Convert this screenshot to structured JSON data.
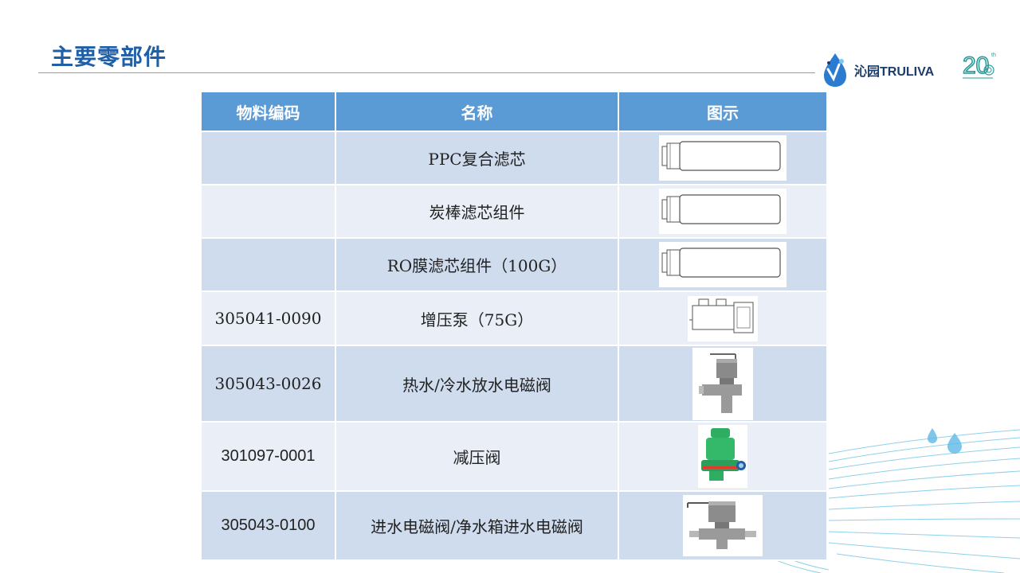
{
  "header": {
    "title": "主要零部件",
    "brand": "沁园TRULIVA",
    "anniversary_number": "20",
    "anniversary_suffix": "th"
  },
  "table": {
    "columns": [
      "物料编码",
      "名称",
      "图示"
    ],
    "rows": [
      {
        "code": "",
        "name": "PPC复合滤芯",
        "image": "filter-cartridge"
      },
      {
        "code": "",
        "name": "炭棒滤芯组件",
        "image": "filter-cartridge"
      },
      {
        "code": "",
        "name": "RO膜滤芯组件（100G）",
        "image": "filter-cartridge"
      },
      {
        "code": "305041-0090",
        "name": "增压泵（75G）",
        "image": "booster-pump"
      },
      {
        "code": "305043-0026",
        "name": "热水/冷水放水电磁阀",
        "image": "solenoid-valve"
      },
      {
        "code": "301097-0001",
        "name": "减压阀",
        "image": "pressure-reducing-valve"
      },
      {
        "code": "305043-0100",
        "name": "进水电磁阀/净水箱进水电磁阀",
        "image": "inlet-solenoid-valve"
      }
    ]
  },
  "colors": {
    "title": "#1f5fa8",
    "header_bg": "#5b9bd5",
    "row_odd": "#cfdcee",
    "row_even": "#e9eef7",
    "brand_blue": "#1a3d6e",
    "accent_teal": "#2a9a9a"
  }
}
